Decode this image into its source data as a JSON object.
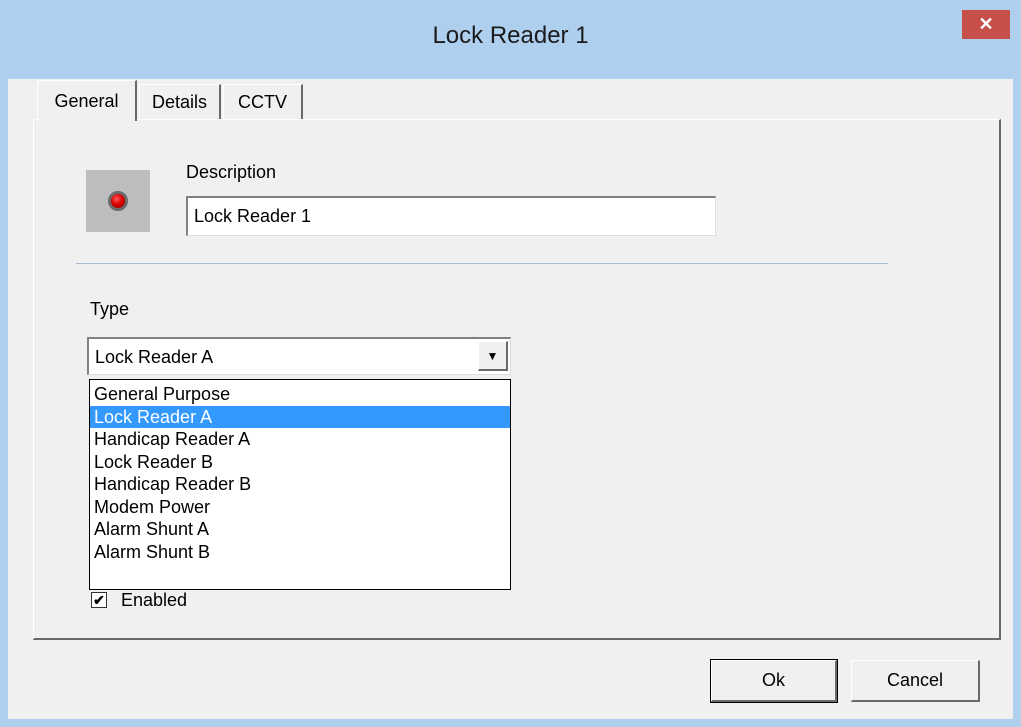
{
  "window": {
    "title": "Lock Reader 1",
    "close_glyph": "✕"
  },
  "tabs": [
    {
      "label": "General",
      "active": true
    },
    {
      "label": "Details",
      "active": false
    },
    {
      "label": "CCTV",
      "active": false
    }
  ],
  "general": {
    "icon": "red-led-icon",
    "description_label": "Description",
    "description_value": "Lock Reader 1",
    "type_label": "Type",
    "type_selected": "Lock Reader A",
    "type_options": [
      "General Purpose",
      "Lock Reader A",
      "Handicap Reader A",
      "Lock Reader B",
      "Handicap Reader B",
      "Modem Power",
      "Alarm Shunt A",
      "Alarm Shunt B"
    ],
    "selected_index": 1,
    "enabled_label": "Enabled",
    "enabled_checked": true,
    "check_glyph": "✔"
  },
  "buttons": {
    "ok_label": "Ok",
    "cancel_label": "Cancel"
  },
  "colors": {
    "titlebar": "#aed0ee",
    "close_button": "#c7504a",
    "selection": "#3399ff",
    "led": "#e00000"
  }
}
